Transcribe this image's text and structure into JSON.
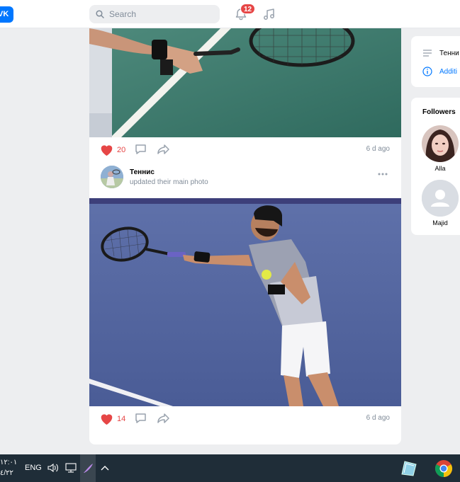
{
  "header": {
    "logo_text": "VK",
    "search_placeholder": "Search",
    "notification_count": "12",
    "icons": [
      "search-icon",
      "bell-icon",
      "music-icon"
    ]
  },
  "feed": {
    "post1": {
      "likes": "20",
      "time": "6 d ago"
    },
    "post2": {
      "author": "Теннис",
      "subtitle": "updated their main photo",
      "likes": "14",
      "time": "6 d ago"
    }
  },
  "sidebar": {
    "items": [
      {
        "label": "Тенни",
        "icon": "list-icon"
      },
      {
        "label": "Additi",
        "icon": "info-icon"
      }
    ],
    "followers_title": "Followers",
    "followers": [
      {
        "name": "Alla"
      },
      {
        "name": "Majid"
      }
    ]
  },
  "taskbar": {
    "time": "۱۲:۰۱",
    "date": "٤/٢٢",
    "language": "ENG"
  },
  "colors": {
    "accent": "#0077ff",
    "like": "#e64646",
    "muted": "#818c99",
    "taskbar": "#1f2d38"
  }
}
